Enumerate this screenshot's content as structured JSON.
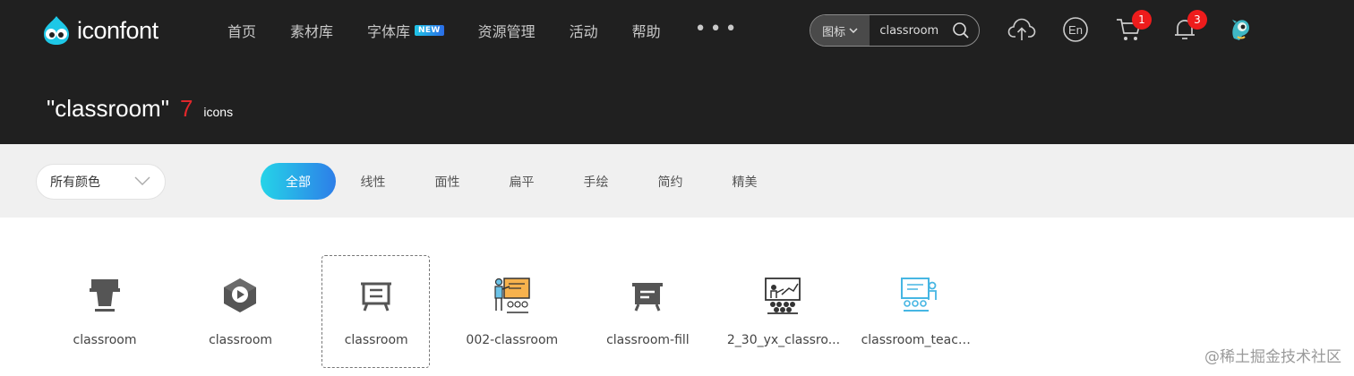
{
  "brand": {
    "name": "iconfont"
  },
  "nav": {
    "items": [
      {
        "label": "首页"
      },
      {
        "label": "素材库"
      },
      {
        "label": "字体库",
        "badge": "NEW"
      },
      {
        "label": "资源管理"
      },
      {
        "label": "活动"
      },
      {
        "label": "帮助"
      }
    ],
    "more": "•••"
  },
  "search": {
    "type_label": "图标",
    "value": "classroom"
  },
  "header_icons": {
    "language": "En",
    "cart_count": "1",
    "notification_count": "3"
  },
  "results": {
    "query": "\"classroom\"",
    "count": "7",
    "unit": "icons"
  },
  "filters": {
    "color_select": "所有颜色",
    "styles": [
      "全部",
      "线性",
      "面性",
      "扁平",
      "手绘",
      "简约",
      "精美"
    ],
    "active_style": "全部"
  },
  "icons": [
    {
      "name": "classroom",
      "icon": "podium-icon"
    },
    {
      "name": "classroom",
      "icon": "cube-play-icon"
    },
    {
      "name": "classroom",
      "icon": "board-outline-icon",
      "hovered": true
    },
    {
      "name": "002-classroom",
      "icon": "teacher-board-color-icon"
    },
    {
      "name": "classroom-fill",
      "icon": "board-fill-icon"
    },
    {
      "name": "2_30_yx_classro...",
      "icon": "lecture-line-icon"
    },
    {
      "name": "classroom_teach...",
      "icon": "teacher-class-blue-icon"
    }
  ],
  "watermark": "@稀土掘金技术社区",
  "colors": {
    "header_bg": "#202020",
    "accent_red": "#e0272b",
    "badge_red": "#ee1c1c",
    "tab_gradient_start": "#25d4e8",
    "tab_gradient_end": "#2d7ee8",
    "filter_bg": "#f0f0f0"
  }
}
